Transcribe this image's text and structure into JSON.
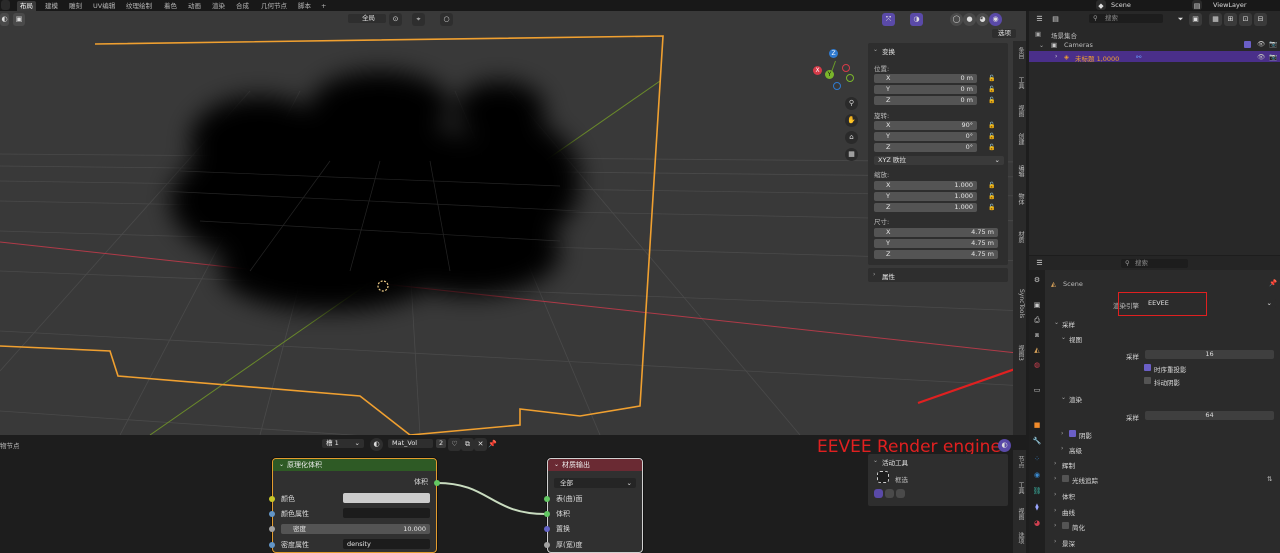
{
  "topbar": {
    "tabs": [
      "布局",
      "建模",
      "雕刻",
      "UV编辑",
      "纹理绘制",
      "着色",
      "动画",
      "渲染",
      "合成",
      "几何节点",
      "脚本"
    ],
    "active_tab": "布局",
    "add_tab": "+",
    "scene": "Scene",
    "view_layer": "ViewLayer"
  },
  "viewport": {
    "transform_orientation": "全局",
    "select_button": "选项",
    "gizmo": {
      "x": "X",
      "y": "Y",
      "z": "Z"
    }
  },
  "npanel": {
    "title": "变换",
    "location_label": "位置:",
    "location": [
      {
        "k": "X",
        "v": "0 m"
      },
      {
        "k": "Y",
        "v": "0 m"
      },
      {
        "k": "Z",
        "v": "0 m"
      }
    ],
    "rotation_label": "旋转:",
    "rotation": [
      {
        "k": "X",
        "v": "90°"
      },
      {
        "k": "Y",
        "v": "0°"
      },
      {
        "k": "Z",
        "v": "0°"
      }
    ],
    "rotation_mode": "XYZ 欧拉",
    "scale_label": "缩放:",
    "scale": [
      {
        "k": "X",
        "v": "1.000"
      },
      {
        "k": "Y",
        "v": "1.000"
      },
      {
        "k": "Z",
        "v": "1.000"
      }
    ],
    "dimensions_label": "尺寸:",
    "dimensions": [
      {
        "k": "X",
        "v": "4.75 m"
      },
      {
        "k": "Y",
        "v": "4.75 m"
      },
      {
        "k": "Z",
        "v": "4.75 m"
      }
    ],
    "attributes": "属性",
    "side_tabs": [
      "条目",
      "工具",
      "视图",
      "创建",
      "编辑",
      "物体",
      "材质",
      "SyncTools",
      "视图3"
    ]
  },
  "node_editor": {
    "left_label": "物节点",
    "slot": "槽 1",
    "material": "Mat_Vol",
    "users": "2",
    "active_tool_title": "活动工具",
    "active_tool": "框选",
    "side_tabs": [
      "节点",
      "工具",
      "视图",
      "选项"
    ],
    "volume_node": {
      "title": "原理化体积",
      "output": "体积",
      "color_label": "颜色",
      "color_attr_label": "颜色属性",
      "density_label": "密度",
      "density_value": "10.000",
      "density_attr_label": "密度属性",
      "density_attr_value": "density"
    },
    "output_node": {
      "title": "材质输出",
      "target": "全部",
      "inputs": [
        "表(曲)面",
        "体积",
        "置换",
        "厚(宽)度"
      ]
    }
  },
  "annotation": {
    "text": "EEVEE Render engine",
    "color": "#e02020"
  },
  "outliner": {
    "search_placeholder": "搜索",
    "collection": "场景集合",
    "cameras": "Cameras",
    "object": "未标题 1,0000"
  },
  "properties": {
    "search_placeholder": "搜索",
    "scene": "Scene",
    "render_engine_label": "渲染引擎",
    "render_engine_value": "EEVEE",
    "sampling": "采样",
    "viewport_sub": "视图",
    "viewport_samples_label": "采样",
    "viewport_samples_value": "16",
    "temporal_reprojection": "时序重投影",
    "jitter_shadows": "抖动阴影",
    "render_sub": "渲染",
    "render_samples_label": "采样",
    "render_samples_value": "64",
    "shadows": "阴影",
    "advanced": "高级",
    "sections": [
      "辉制",
      "光线追踪",
      "体积",
      "曲线",
      "简化",
      "景深"
    ]
  },
  "colors": {
    "accent": "#6b5fc7",
    "selection_orange": "#f0a030",
    "node_volume_header": "#2e5a25",
    "node_output_header": "#6a2a33"
  }
}
